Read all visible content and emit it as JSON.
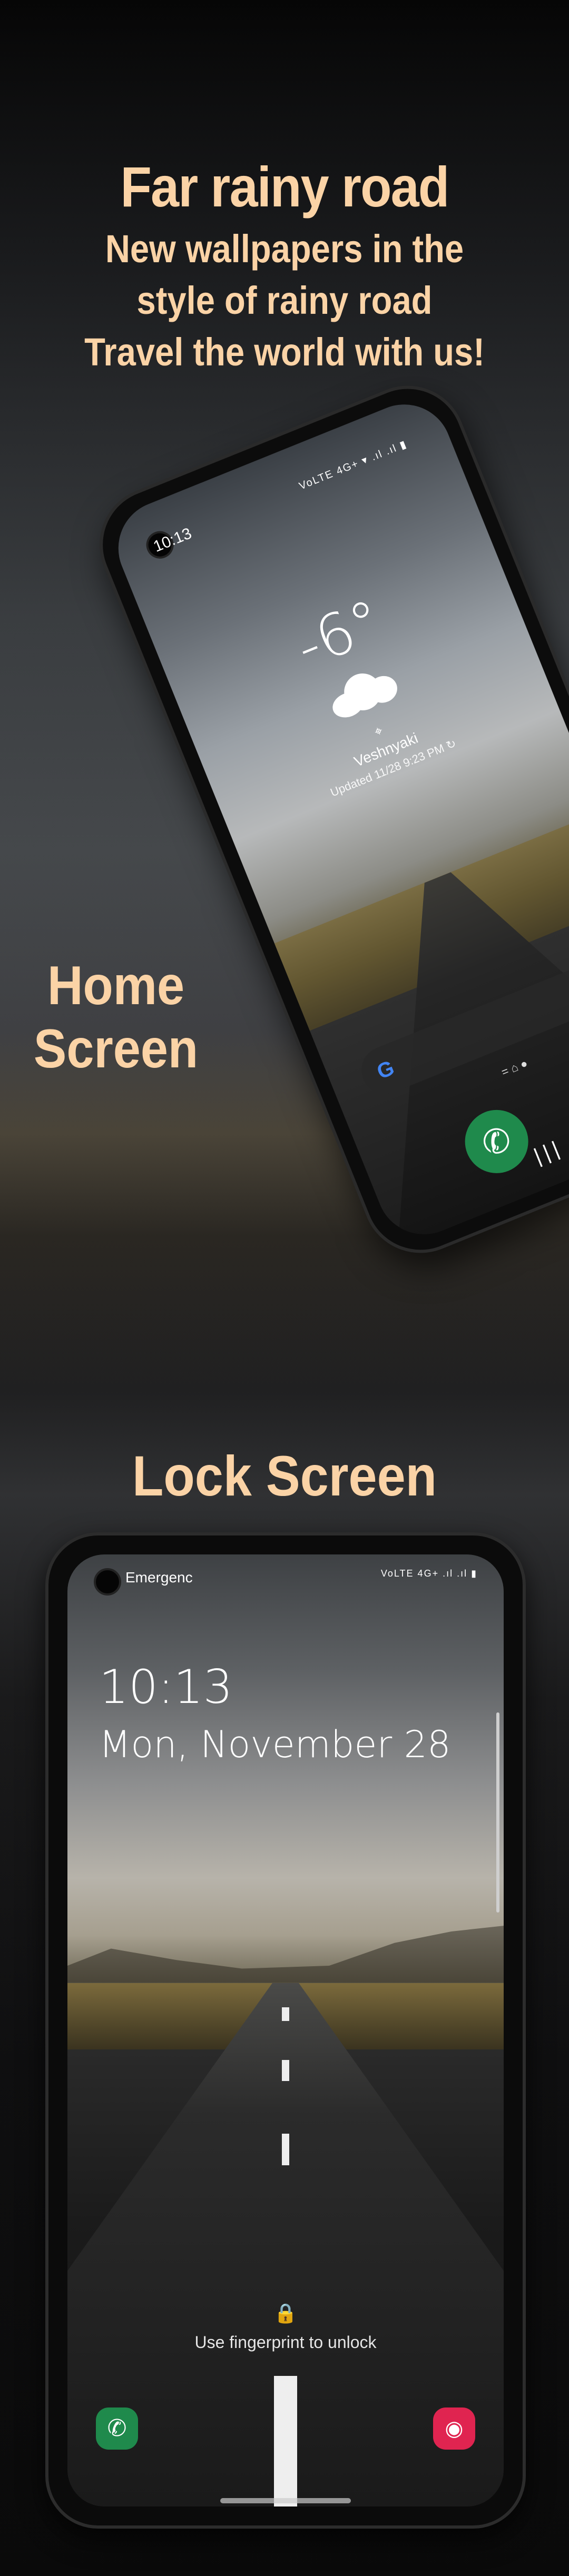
{
  "promo": {
    "title": "Far rainy road",
    "line1": "New wallpapers in the",
    "line2": "style of rainy road",
    "line3": "Travel the world with us!",
    "home_label_1": "Home",
    "home_label_2": "Screen",
    "lock_label": "Lock Screen"
  },
  "home_screen": {
    "time": "10:13",
    "status_icons": "VoLTE 4G+ ▾ .ıl .ıl ▮",
    "temperature": "-6°",
    "location": "Veshnyaki",
    "updated": "Updated 11/28 9:23 PM ↻",
    "google_glyph": "G",
    "page_dots": "= ⌂ ●",
    "nav_glyph": "|||",
    "phone_glyph": "✆",
    "camera_glyph": "◉"
  },
  "lock_screen": {
    "carrier_text": "Emergenc",
    "status_icons": "VoLTE 4G+ .ıl .ıl ▮",
    "time": "10:13",
    "date": "Mon, November 28",
    "lock_glyph": "🔒",
    "unlock_hint": "Use fingerprint to unlock",
    "phone_glyph": "✆",
    "camera_glyph": "◉"
  },
  "colors": {
    "accent_text": "#fbd3a6",
    "phone_app": "#1f8a4c",
    "camera_app": "#e02450"
  }
}
